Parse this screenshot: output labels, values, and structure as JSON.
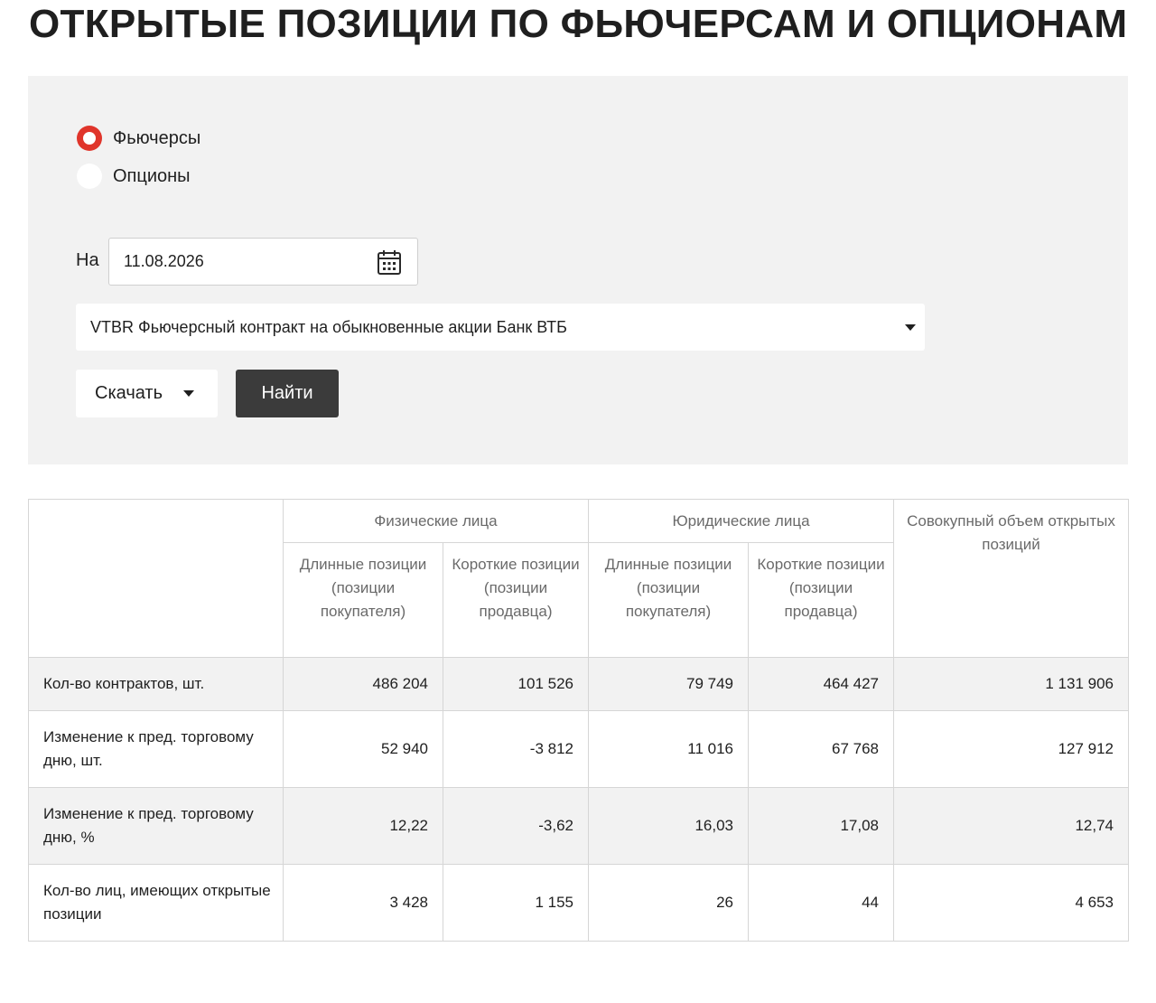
{
  "page": {
    "title": "ОТКРЫТЫЕ ПОЗИЦИИ ПО ФЬЮЧЕРСАМ И ОПЦИОНАМ"
  },
  "filters": {
    "instrument_types": [
      {
        "label": "Фьючерсы",
        "checked": true
      },
      {
        "label": "Опционы",
        "checked": false
      }
    ],
    "date_label": "На",
    "date_value": "11.08.2026",
    "instrument_selected": "VTBR Фьючерсный контракт на обыкновенные акции Банк ВТБ",
    "download_label": "Скачать",
    "find_label": "Найти"
  },
  "table": {
    "group_headers": {
      "individuals": "Физические лица",
      "legal": "Юридические лица",
      "total": "Совокупный объем открытых позиций"
    },
    "sub_headers": {
      "long": "Длинные позиции (позиции покупателя)",
      "short": "Короткие позиции (позиции продавца)"
    },
    "rows": [
      {
        "label": "Кол-во контрактов, шт.",
        "ind_long": "486 204",
        "ind_short": "101 526",
        "leg_long": "79 749",
        "leg_short": "464 427",
        "total": "1 131 906"
      },
      {
        "label": "Изменение к пред. торговому дню, шт.",
        "ind_long": "52 940",
        "ind_short": "-3 812",
        "leg_long": "11 016",
        "leg_short": "67 768",
        "total": "127 912"
      },
      {
        "label": "Изменение к пред. торговому дню, %",
        "ind_long": "12,22",
        "ind_short": "-3,62",
        "leg_long": "16,03",
        "leg_short": "17,08",
        "total": "12,74"
      },
      {
        "label": "Кол-во лиц, имеющих открытые позиции",
        "ind_long": "3 428",
        "ind_short": "1 155",
        "leg_long": "26",
        "leg_short": "44",
        "total": "4 653"
      }
    ]
  },
  "colors": {
    "accent": "#e0352b",
    "button_dark": "#3b3b3b",
    "panel_bg": "#f2f2f2"
  }
}
